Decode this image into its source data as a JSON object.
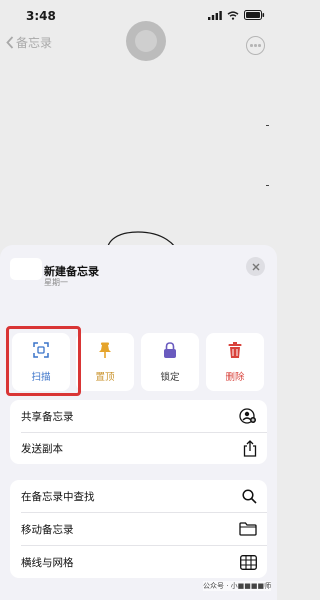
{
  "status_bar": {
    "time": "3:48"
  },
  "nav": {
    "back_label": "备忘录"
  },
  "note": {
    "title": "新建备忘录",
    "subtitle": "星期一"
  },
  "actions": [
    {
      "label": "扫描",
      "icon": "scan-icon",
      "color": "#3a73c9"
    },
    {
      "label": "置顶",
      "icon": "pin-icon",
      "color": "#e5a42b"
    },
    {
      "label": "锁定",
      "icon": "lock-icon",
      "color": "#6a5bbf"
    },
    {
      "label": "删除",
      "icon": "trash-icon",
      "color": "#d8423b"
    }
  ],
  "menu_group_1": [
    {
      "label": "共享备忘录",
      "icon": "share-person-icon"
    },
    {
      "label": "发送副本",
      "icon": "share-upload-icon"
    }
  ],
  "menu_group_2": [
    {
      "label": "在备忘录中查找",
      "icon": "search-icon"
    },
    {
      "label": "移动备忘录",
      "icon": "folder-icon"
    },
    {
      "label": "横线与网格",
      "icon": "grid-icon"
    }
  ],
  "watermark": {
    "text": "公众号 · 小■■■■师"
  },
  "colors": {
    "highlight": "#d93535",
    "accent": "#3a73c9"
  }
}
